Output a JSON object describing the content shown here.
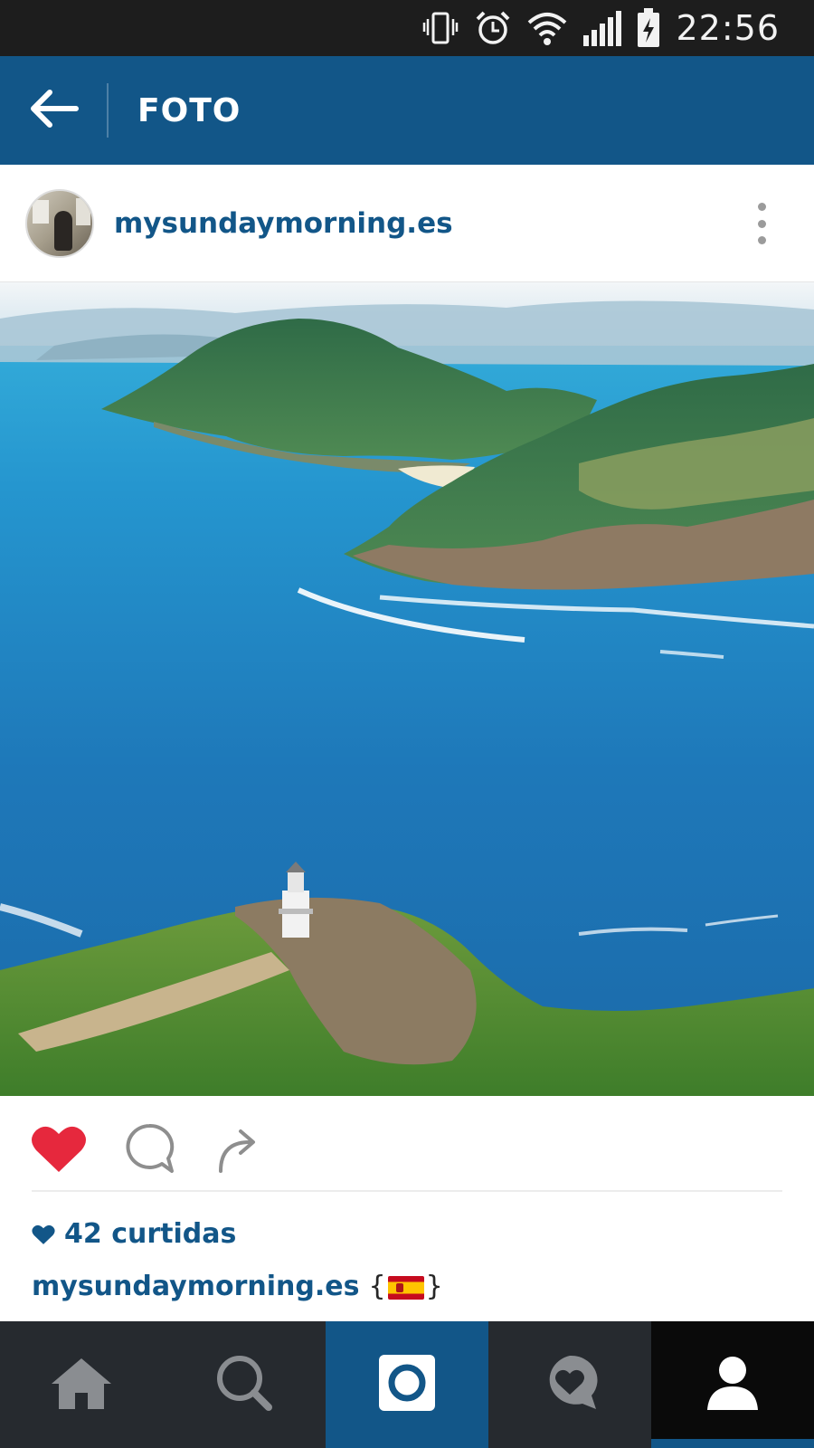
{
  "status_bar": {
    "time": "22:56",
    "icons": [
      "vibrate-icon",
      "alarm-icon",
      "wifi-icon",
      "signal-icon",
      "battery-charging-icon"
    ]
  },
  "header": {
    "title": "FOTO",
    "back_icon": "arrow-left-icon"
  },
  "post": {
    "username": "mysundaymorning.es",
    "avatar_icon": "avatar-photo",
    "more_icon": "more-vertical-icon",
    "photo": "coastal-landscape-photo",
    "liked": true,
    "likes_text": "42 curtidas",
    "caption_user": "mysundaymorning.es",
    "caption_open": "{",
    "caption_flag": "🇪🇸",
    "caption_close": "}"
  },
  "actions": {
    "like_icon": "heart-filled-icon",
    "comment_icon": "comment-icon",
    "share_icon": "share-arrow-icon"
  },
  "colors": {
    "brand": "#125688",
    "like_red": "#e6283d",
    "status_bar": "#1d1d1d",
    "bottom_nav": "#262a2f"
  },
  "bottom_nav": {
    "tabs": [
      {
        "icon": "home-icon",
        "active": false
      },
      {
        "icon": "search-icon",
        "active": false
      },
      {
        "icon": "camera-icon",
        "active": false
      },
      {
        "icon": "activity-heart-icon",
        "active": false
      },
      {
        "icon": "profile-icon",
        "active": true
      }
    ]
  }
}
